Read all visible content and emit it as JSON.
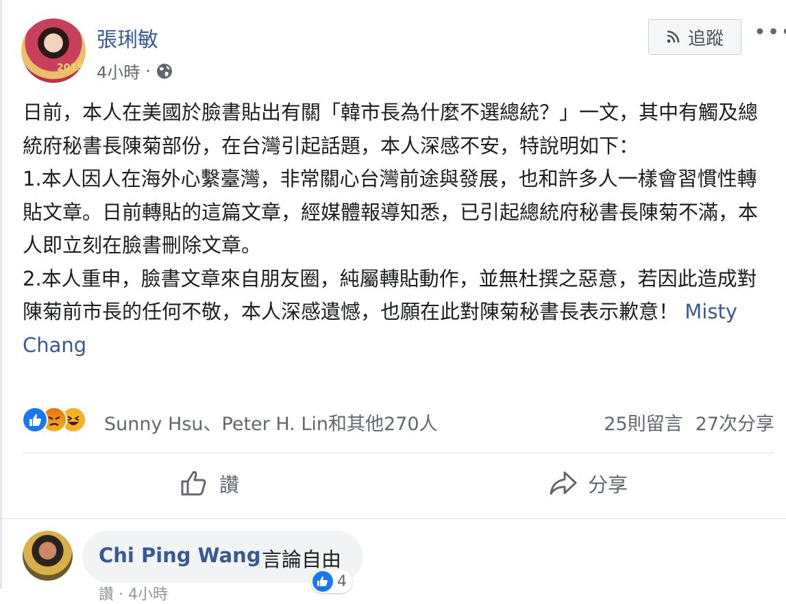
{
  "post": {
    "author_name": "張琍敏",
    "avatar_year": "2019",
    "timestamp": "4小時",
    "separator": "·",
    "follow_label": "追蹤",
    "more_label": "•••",
    "paragraphs": [
      "日前，本人在美國於臉書貼出有關「韓市長為什麼不選總統？」一文，其中有觸及總統府秘書長陳菊部份，在台灣引起話題，本人深感不安，特說明如下：",
      "1.本人因人在海外心繫臺灣，非常關心台灣前途與發展，也和許多人一樣會習慣性轉貼文章。日前轉貼的這篇文章，經媒體報導知悉，已引起總統府秘書長陳菊不滿，本人即立刻在臉書刪除文章。"
    ],
    "paragraph3": "2.本人重申，臉書文章來自朋友圈，純屬轉貼動作，並無杜撰之惡意，若因此造成對陳菊前市長的任何不敬，本人深感遺憾，也願在此對陳菊秘書長表示歉意！",
    "mention": "Misty Chang"
  },
  "reactions": {
    "summary": "Sunny Hsu、Peter H. Lin和其他270人",
    "comments": "25則留言",
    "shares": "27次分享"
  },
  "actions": {
    "like_label": "讚",
    "share_label": "分享"
  },
  "comment": {
    "author": "Chi Ping Wang",
    "text": "言論自由",
    "like_count": "4",
    "footer": "讚 · 4小時"
  }
}
